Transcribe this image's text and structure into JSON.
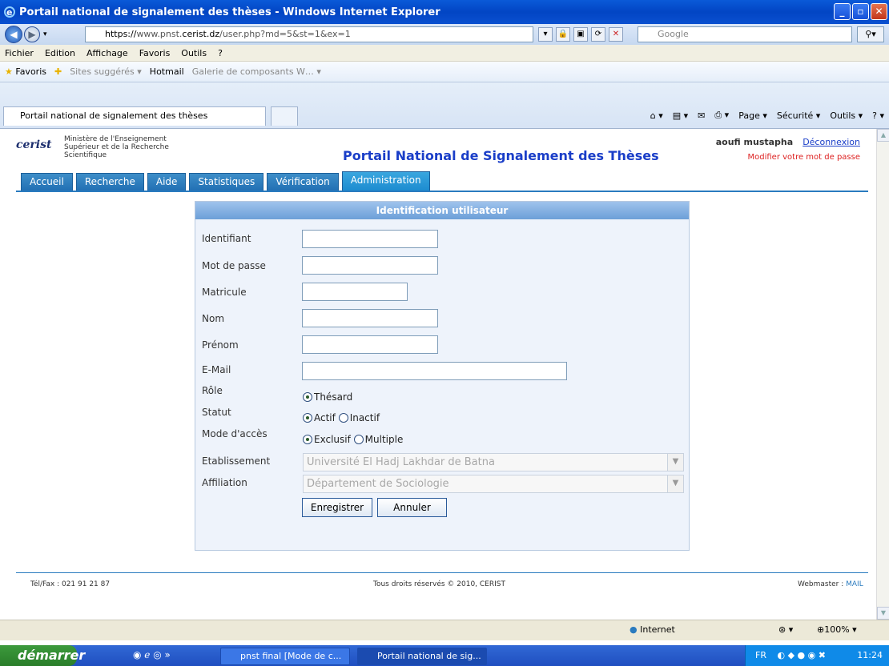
{
  "window": {
    "title": "Portail national de signalement des thèses - Windows Internet Explorer"
  },
  "address": {
    "url_scheme": "https://",
    "url_prefix": "www.pnst.",
    "url_host": "cerist.dz",
    "url_path": "/user.php?md=5&st=1&ex=1",
    "search_placeholder": "Google"
  },
  "menu": [
    "Fichier",
    "Edition",
    "Affichage",
    "Favoris",
    "Outils",
    "?"
  ],
  "favorites": {
    "label": "Favoris",
    "items": [
      "Sites suggérés ▾",
      "Hotmail",
      "Galerie de composants W… ▾"
    ]
  },
  "tab": {
    "label": "Portail national de signalement des thèses"
  },
  "commands": [
    "Page ▾",
    "Sécurité ▾",
    "Outils ▾"
  ],
  "site": {
    "logo": "cerist",
    "ministry": "Ministère de l'Enseignement Supérieur et de la Recherche Scientifique",
    "title": "Portail National de Signalement des Thèses",
    "user": "aoufi mustapha",
    "logout": "Déconnexion",
    "change_password": "Modifier votre mot de passe",
    "nav": [
      "Accueil",
      "Recherche",
      "Aide",
      "Statistiques",
      "Vérification",
      "Administration"
    ],
    "active_nav": "Administration"
  },
  "form": {
    "heading": "Identification utilisateur",
    "labels": {
      "identifiant": "Identifiant",
      "mot_de_passe": "Mot de passe",
      "matricule": "Matricule",
      "nom": "Nom",
      "prenom": "Prénom",
      "email": "E-Mail",
      "role": "Rôle",
      "statut": "Statut",
      "mode": "Mode d'accès",
      "etablissement": "Etablissement",
      "affiliation": "Affiliation"
    },
    "values": {
      "identifiant": "",
      "mot_de_passe": "",
      "matricule": "",
      "nom": "",
      "prenom": "",
      "email": ""
    },
    "role_options": [
      "Thésard"
    ],
    "statut_options": [
      "Actif",
      "Inactif"
    ],
    "mode_options": [
      "Exclusif",
      "Multiple"
    ],
    "etablissement": "Université El Hadj Lakhdar de Batna",
    "affiliation": "Département de Sociologie",
    "save": "Enregistrer",
    "cancel": "Annuler"
  },
  "footer": {
    "phone": "Tél/Fax : 021 91 21 87",
    "copyright": "Tous droits réservés © 2010, CERIST",
    "webmaster_label": "Webmaster : ",
    "webmaster_link": "MAIL"
  },
  "status": {
    "zone": "Internet",
    "zoom": "100%"
  },
  "taskbar": {
    "start": "démarrer",
    "items": [
      "pnst final [Mode de c...",
      "Portail national de sig..."
    ],
    "lang": "FR",
    "time": "11:24"
  }
}
